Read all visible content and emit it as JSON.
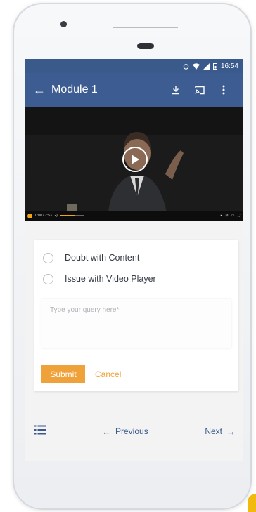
{
  "status_bar": {
    "time": "16:54"
  },
  "app_bar": {
    "title": "Module 1",
    "icons": [
      "back-arrow-icon",
      "download-icon",
      "cast-icon",
      "more-vert-icon"
    ]
  },
  "video": {
    "playback_text": "0:00 / 2:53",
    "controls": [
      "play-icon",
      "volume-icon",
      "settings-icon",
      "fullscreen-icon"
    ]
  },
  "query_form": {
    "options": [
      {
        "label": "Doubt with Content",
        "selected": false
      },
      {
        "label": "Issue with Video Player",
        "selected": false
      }
    ],
    "query_placeholder": "Type your query here*",
    "submit_label": "Submit",
    "cancel_label": "Cancel"
  },
  "bottom_nav": {
    "previous_label": "Previous",
    "next_label": "Next",
    "previous_arrow": "←",
    "next_arrow": "→"
  },
  "colors": {
    "status_bar": "#3a5a8c",
    "app_bar": "#3d5c92",
    "accent": "#f0a23a",
    "nav_text": "#3a5a8c"
  }
}
